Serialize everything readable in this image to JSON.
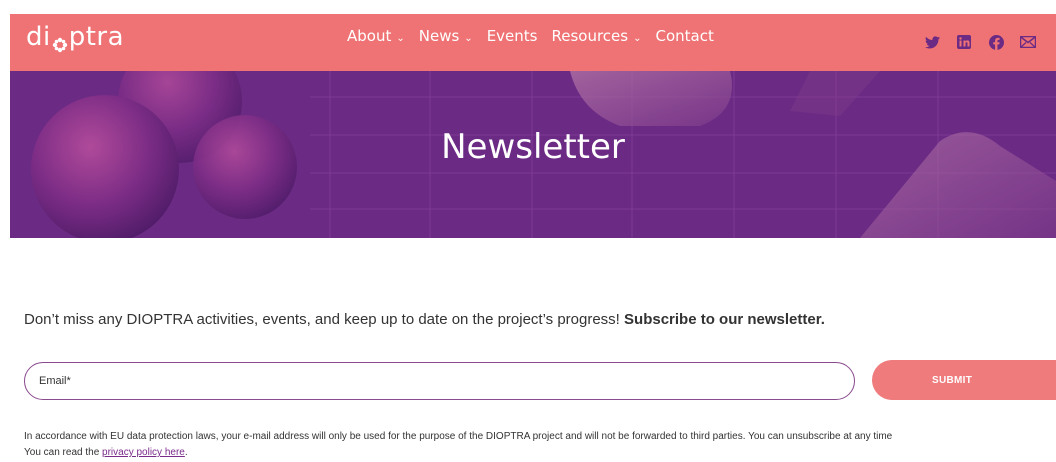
{
  "brand": {
    "logo_prefix": "di",
    "logo_suffix": "ptra",
    "nav_color": "#ef7374",
    "hero_color": "#6b2a84",
    "accent_color": "#ef7b7d"
  },
  "nav": {
    "items": [
      {
        "label": "About",
        "has_dropdown": true
      },
      {
        "label": "News",
        "has_dropdown": true
      },
      {
        "label": "Events",
        "has_dropdown": false
      },
      {
        "label": "Resources",
        "has_dropdown": true
      },
      {
        "label": "Contact",
        "has_dropdown": false
      }
    ],
    "dropdown_glyph": "⌄",
    "social_icons": [
      "twitter-icon",
      "linkedin-icon",
      "facebook-icon",
      "email-icon"
    ]
  },
  "hero": {
    "title": "Newsletter"
  },
  "content": {
    "intro_text": "Don’t miss any DIOPTRA activities, events, and keep up to date on the project’s progress! ",
    "intro_bold": "Subscribe to our newsletter."
  },
  "form": {
    "email_placeholder": "Email*",
    "submit_label": "SUBMIT"
  },
  "notice": {
    "line1": "In accordance with EU data protection laws, your e-mail address will only be used for the purpose of the DIOPTRA project and will not be forwarded to third parties. You can unsubscribe at any time",
    "line2_prefix": "You can read the ",
    "link_text": "privacy policy here",
    "line2_suffix": "."
  }
}
